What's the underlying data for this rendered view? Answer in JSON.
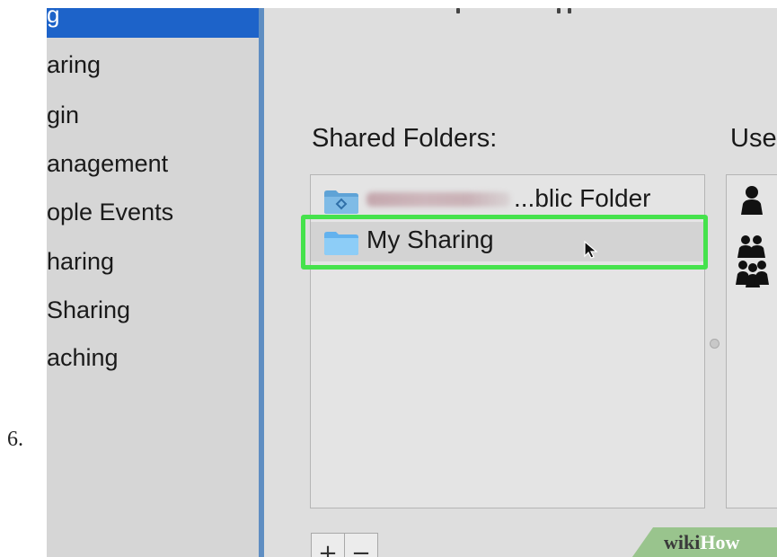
{
  "step": {
    "number": "6."
  },
  "sidebar": {
    "selected_label": "g",
    "items": [
      {
        "label": "aring"
      },
      {
        "label": "gin"
      },
      {
        "label": "anagement"
      },
      {
        "label": "ople Events"
      },
      {
        "label": "haring"
      },
      {
        "label": "Sharing"
      },
      {
        "label": "aching"
      }
    ],
    "selected_color": "#1d63c9"
  },
  "main": {
    "shared_folders_label": "Shared Folders:",
    "users_label": "Use",
    "folders": [
      {
        "name_suffix": "...blic Folder",
        "icon": "public-folder-icon",
        "name_obscured": true
      },
      {
        "name": "My Sharing",
        "icon": "folder-icon",
        "highlighted": true
      }
    ],
    "users_icons": [
      "user-icon",
      "group-icon",
      "everyone-icon"
    ],
    "buttons": {
      "add_label": "+",
      "remove_label": "−"
    }
  },
  "highlight_color": "#45e24c",
  "watermark": {
    "wiki": "wiki",
    "how": "How"
  }
}
